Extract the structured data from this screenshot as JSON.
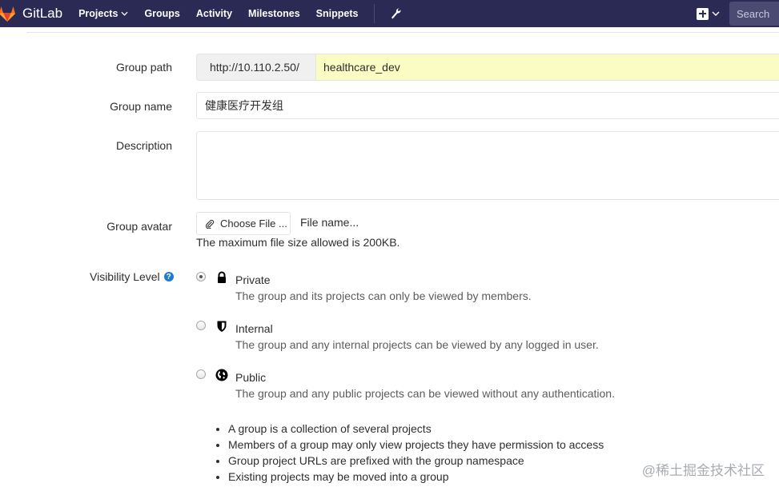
{
  "navbar": {
    "brand": "GitLab",
    "items": [
      {
        "label": "Projects",
        "has_dropdown": true
      },
      {
        "label": "Groups",
        "has_dropdown": false
      },
      {
        "label": "Activity",
        "has_dropdown": false
      },
      {
        "label": "Milestones",
        "has_dropdown": false
      },
      {
        "label": "Snippets",
        "has_dropdown": false
      }
    ],
    "admin_icon": "wrench-icon",
    "new_icon": "plus-square-icon",
    "search_placeholder": "Search"
  },
  "form": {
    "group_path": {
      "label": "Group path",
      "prefix": "http://10.110.2.50/",
      "value": "healthcare_dev"
    },
    "group_name": {
      "label": "Group name",
      "value": "健康医疗开发组"
    },
    "description": {
      "label": "Description",
      "value": ""
    },
    "group_avatar": {
      "label": "Group avatar",
      "button_label": "Choose File ...",
      "file_name": "File name...",
      "help": "The maximum file size allowed is 200KB."
    },
    "visibility": {
      "label": "Visibility Level",
      "help_icon": "?",
      "options": [
        {
          "title": "Private",
          "icon": "lock-icon",
          "description": "The group and its projects can only be viewed by members.",
          "checked": true
        },
        {
          "title": "Internal",
          "icon": "shield-icon",
          "description": "The group and any internal projects can be viewed by any logged in user.",
          "checked": false
        },
        {
          "title": "Public",
          "icon": "globe-icon",
          "description": "The group and any public projects can be viewed without any authentication.",
          "checked": false
        }
      ]
    },
    "notes": [
      "A group is a collection of several projects",
      "Members of a group may only view projects they have permission to access",
      "Group project URLs are prefixed with the group namespace",
      "Existing projects may be moved into a group"
    ]
  },
  "watermark": "@稀土掘金技术社区"
}
